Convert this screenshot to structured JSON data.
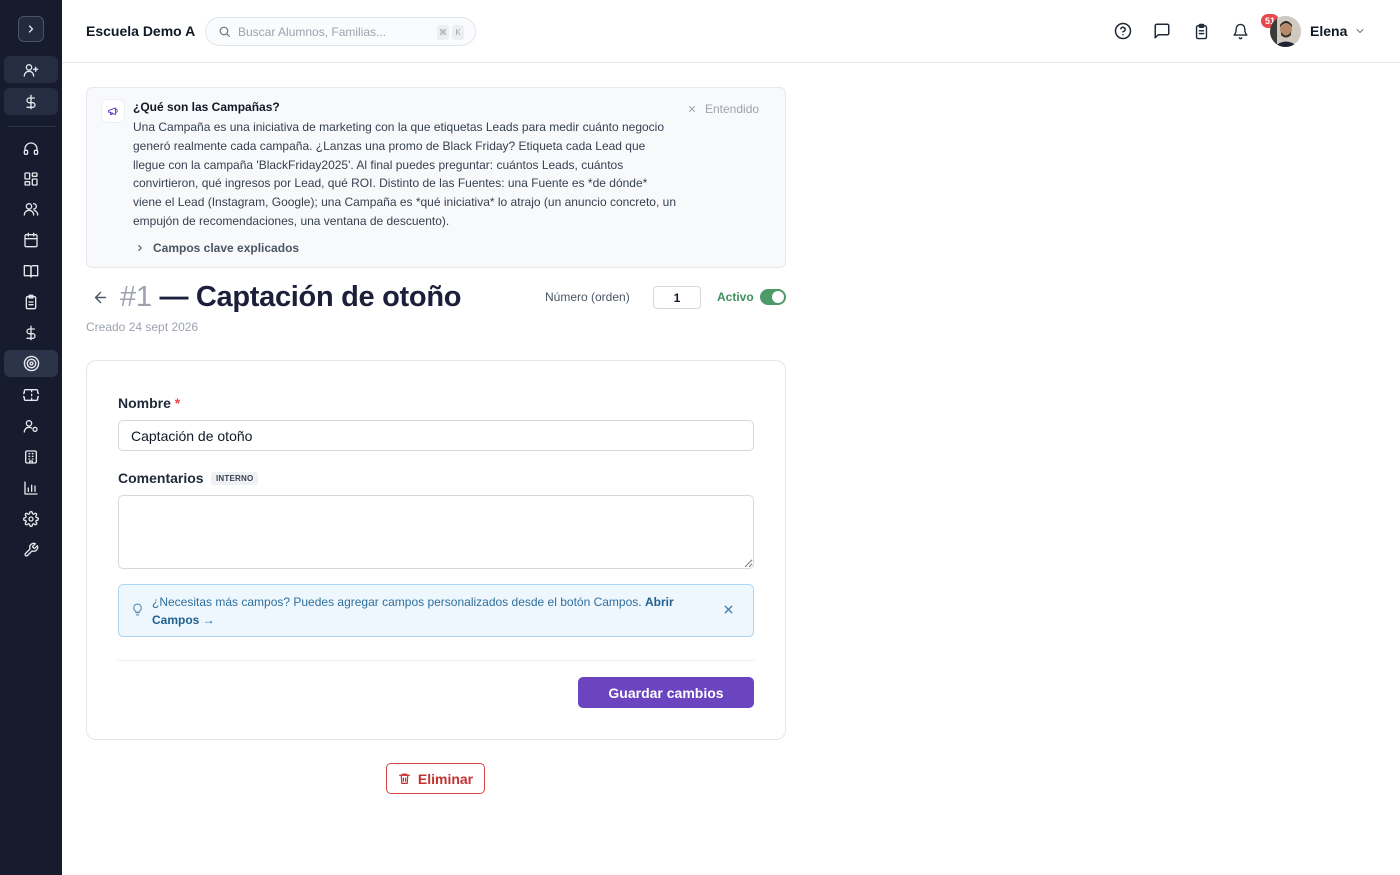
{
  "topbar": {
    "school_name": "Escuela Demo A",
    "search_placeholder": "Buscar Alumnos, Familias...",
    "shortcut_keys": [
      "⌘",
      "K"
    ],
    "notification_count": "51",
    "user_name": "Elena"
  },
  "sidebar": {
    "icons": [
      "chevron-right-icon",
      "user-plus-icon",
      "dollar-icon",
      "headset-icon",
      "grid-icon",
      "users-icon",
      "calendar-icon",
      "book-icon",
      "clipboard-icon",
      "dollar-icon",
      "target-icon",
      "ticket-icon",
      "user-settings-icon",
      "building-icon",
      "bar-chart-icon",
      "gear-icon",
      "wrench-icon"
    ],
    "active_item": "target-icon"
  },
  "info": {
    "title": "¿Qué son las Campañas?",
    "body": "Una Campaña es una iniciativa de marketing con la que etiquetas Leads para medir cuánto negocio generó realmente cada campaña. ¿Lanzas una promo de Black Friday? Etiqueta cada Lead que llegue con la campaña 'BlackFriday2025'. Al final puedes preguntar: cuántos Leads, cuántos convirtieron, qué ingresos por Lead, qué ROI. Distinto de las Fuentes: una Fuente es *de dónde* viene el Lead (Instagram, Google); una Campaña es *qué iniciativa* lo atrajo (un anuncio concreto, un empujón de recomendaciones, una ventana de descuento).",
    "dismiss_label": "Entendido",
    "more_label": "Campos clave explicados"
  },
  "header": {
    "number": "#1",
    "title": "— Captación de otoño",
    "created": "Creado 24 sept 2026",
    "order_label": "Número (orden)",
    "order_value": "1",
    "active_label": "Activo",
    "active": true
  },
  "form": {
    "name_label": "Nombre",
    "required_mark": "*",
    "name_value": "Captación de otoño",
    "comments_label": "Comentarios",
    "comments_tag": "INTERNO",
    "comments_value": "",
    "hint_text": "¿Necesitas más campos? Puedes agregar campos personalizados desde el botón Campos.",
    "hint_link": "Abrir Campos →",
    "save_label": "Guardar cambios"
  },
  "delete_label": "Eliminar",
  "colors": {
    "sidebar": "#161b2e",
    "primary": "#6b44c0",
    "danger": "#c53030",
    "active_green": "#4d9a68",
    "hint_bg": "#eef7fd"
  }
}
